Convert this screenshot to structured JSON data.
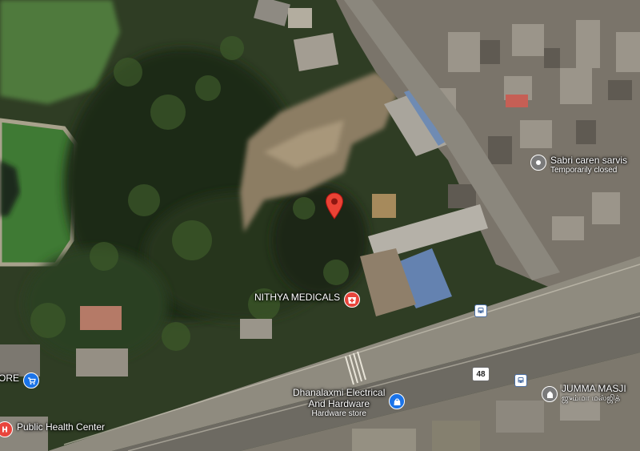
{
  "map": {
    "type": "satellite"
  },
  "pois": {
    "nithya": {
      "name": "NITHYA MEDICALS",
      "icon": "pharmacy-icon",
      "color": "#e8453c"
    },
    "sabri": {
      "name": "Sabri caren sarvis",
      "status": "Temporarily closed",
      "icon": "generic-place-icon",
      "color": "#7a7a7a"
    },
    "dhanalaxmi": {
      "name_line1": "Dhanalaxmi Electrical",
      "name_line2": "And Hardware",
      "category": "Hardware store",
      "icon": "shopping-bag-icon",
      "color": "#1a73e8"
    },
    "jumma": {
      "name": "JUMMA MASJI",
      "local_name": "ஜும்மா மஸ்ஜித்",
      "icon": "mosque-icon",
      "color": "#7a7a7a"
    },
    "public_health": {
      "name": "Public Health Center",
      "icon": "hospital-icon",
      "color": "#e8453c"
    },
    "store": {
      "name": "ORE",
      "icon": "shopping-cart-icon",
      "color": "#1a73e8"
    }
  },
  "route": {
    "number": "48"
  },
  "selected_pin": {
    "icon": "location-pin-icon",
    "color": "#ea4335"
  }
}
